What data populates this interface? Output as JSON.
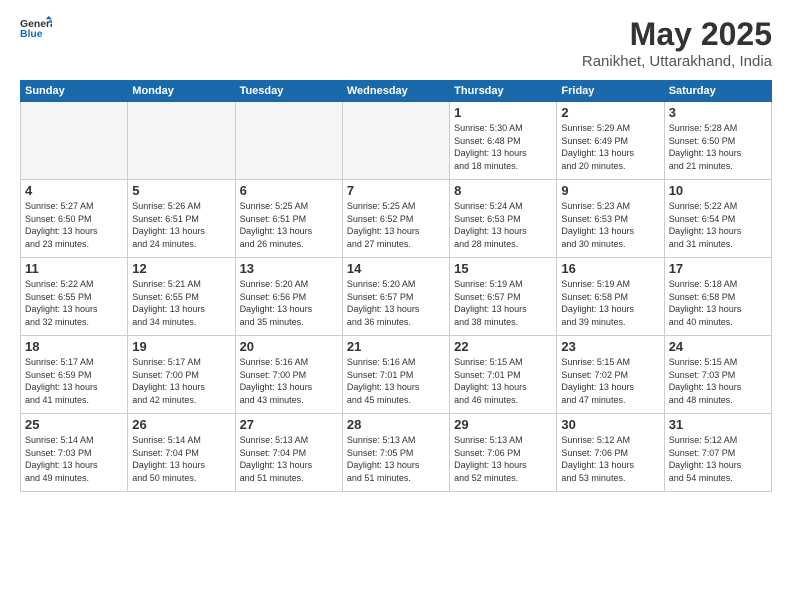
{
  "logo": {
    "general": "General",
    "blue": "Blue"
  },
  "title": "May 2025",
  "subtitle": "Ranikhet, Uttarakhand, India",
  "headers": [
    "Sunday",
    "Monday",
    "Tuesday",
    "Wednesday",
    "Thursday",
    "Friday",
    "Saturday"
  ],
  "weeks": [
    [
      {
        "num": "",
        "info": ""
      },
      {
        "num": "",
        "info": ""
      },
      {
        "num": "",
        "info": ""
      },
      {
        "num": "",
        "info": ""
      },
      {
        "num": "1",
        "info": "Sunrise: 5:30 AM\nSunset: 6:48 PM\nDaylight: 13 hours\nand 18 minutes."
      },
      {
        "num": "2",
        "info": "Sunrise: 5:29 AM\nSunset: 6:49 PM\nDaylight: 13 hours\nand 20 minutes."
      },
      {
        "num": "3",
        "info": "Sunrise: 5:28 AM\nSunset: 6:50 PM\nDaylight: 13 hours\nand 21 minutes."
      }
    ],
    [
      {
        "num": "4",
        "info": "Sunrise: 5:27 AM\nSunset: 6:50 PM\nDaylight: 13 hours\nand 23 minutes."
      },
      {
        "num": "5",
        "info": "Sunrise: 5:26 AM\nSunset: 6:51 PM\nDaylight: 13 hours\nand 24 minutes."
      },
      {
        "num": "6",
        "info": "Sunrise: 5:25 AM\nSunset: 6:51 PM\nDaylight: 13 hours\nand 26 minutes."
      },
      {
        "num": "7",
        "info": "Sunrise: 5:25 AM\nSunset: 6:52 PM\nDaylight: 13 hours\nand 27 minutes."
      },
      {
        "num": "8",
        "info": "Sunrise: 5:24 AM\nSunset: 6:53 PM\nDaylight: 13 hours\nand 28 minutes."
      },
      {
        "num": "9",
        "info": "Sunrise: 5:23 AM\nSunset: 6:53 PM\nDaylight: 13 hours\nand 30 minutes."
      },
      {
        "num": "10",
        "info": "Sunrise: 5:22 AM\nSunset: 6:54 PM\nDaylight: 13 hours\nand 31 minutes."
      }
    ],
    [
      {
        "num": "11",
        "info": "Sunrise: 5:22 AM\nSunset: 6:55 PM\nDaylight: 13 hours\nand 32 minutes."
      },
      {
        "num": "12",
        "info": "Sunrise: 5:21 AM\nSunset: 6:55 PM\nDaylight: 13 hours\nand 34 minutes."
      },
      {
        "num": "13",
        "info": "Sunrise: 5:20 AM\nSunset: 6:56 PM\nDaylight: 13 hours\nand 35 minutes."
      },
      {
        "num": "14",
        "info": "Sunrise: 5:20 AM\nSunset: 6:57 PM\nDaylight: 13 hours\nand 36 minutes."
      },
      {
        "num": "15",
        "info": "Sunrise: 5:19 AM\nSunset: 6:57 PM\nDaylight: 13 hours\nand 38 minutes."
      },
      {
        "num": "16",
        "info": "Sunrise: 5:19 AM\nSunset: 6:58 PM\nDaylight: 13 hours\nand 39 minutes."
      },
      {
        "num": "17",
        "info": "Sunrise: 5:18 AM\nSunset: 6:58 PM\nDaylight: 13 hours\nand 40 minutes."
      }
    ],
    [
      {
        "num": "18",
        "info": "Sunrise: 5:17 AM\nSunset: 6:59 PM\nDaylight: 13 hours\nand 41 minutes."
      },
      {
        "num": "19",
        "info": "Sunrise: 5:17 AM\nSunset: 7:00 PM\nDaylight: 13 hours\nand 42 minutes."
      },
      {
        "num": "20",
        "info": "Sunrise: 5:16 AM\nSunset: 7:00 PM\nDaylight: 13 hours\nand 43 minutes."
      },
      {
        "num": "21",
        "info": "Sunrise: 5:16 AM\nSunset: 7:01 PM\nDaylight: 13 hours\nand 45 minutes."
      },
      {
        "num": "22",
        "info": "Sunrise: 5:15 AM\nSunset: 7:01 PM\nDaylight: 13 hours\nand 46 minutes."
      },
      {
        "num": "23",
        "info": "Sunrise: 5:15 AM\nSunset: 7:02 PM\nDaylight: 13 hours\nand 47 minutes."
      },
      {
        "num": "24",
        "info": "Sunrise: 5:15 AM\nSunset: 7:03 PM\nDaylight: 13 hours\nand 48 minutes."
      }
    ],
    [
      {
        "num": "25",
        "info": "Sunrise: 5:14 AM\nSunset: 7:03 PM\nDaylight: 13 hours\nand 49 minutes."
      },
      {
        "num": "26",
        "info": "Sunrise: 5:14 AM\nSunset: 7:04 PM\nDaylight: 13 hours\nand 50 minutes."
      },
      {
        "num": "27",
        "info": "Sunrise: 5:13 AM\nSunset: 7:04 PM\nDaylight: 13 hours\nand 51 minutes."
      },
      {
        "num": "28",
        "info": "Sunrise: 5:13 AM\nSunset: 7:05 PM\nDaylight: 13 hours\nand 51 minutes."
      },
      {
        "num": "29",
        "info": "Sunrise: 5:13 AM\nSunset: 7:06 PM\nDaylight: 13 hours\nand 52 minutes."
      },
      {
        "num": "30",
        "info": "Sunrise: 5:12 AM\nSunset: 7:06 PM\nDaylight: 13 hours\nand 53 minutes."
      },
      {
        "num": "31",
        "info": "Sunrise: 5:12 AM\nSunset: 7:07 PM\nDaylight: 13 hours\nand 54 minutes."
      }
    ]
  ]
}
